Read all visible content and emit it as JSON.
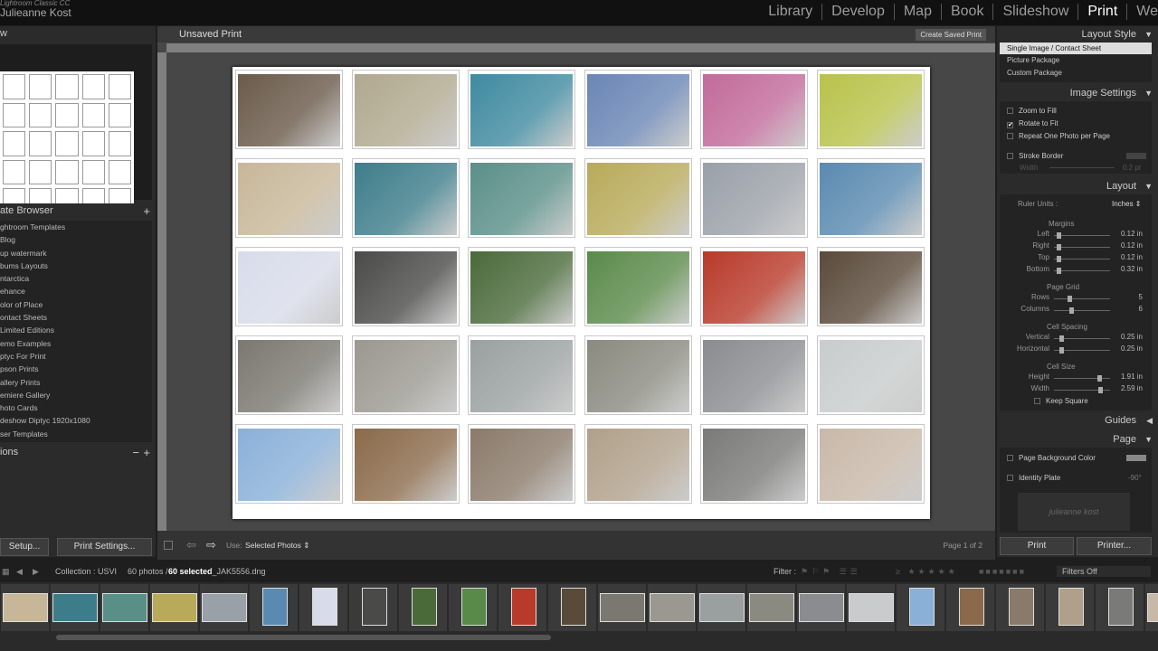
{
  "app": {
    "brand_line1": "Lightroom Classic CC",
    "brand_line2": "Julieanne Kost"
  },
  "modules": [
    {
      "label": "Library"
    },
    {
      "label": "Develop"
    },
    {
      "label": "Map"
    },
    {
      "label": "Book"
    },
    {
      "label": "Slideshow"
    },
    {
      "label": "Print",
      "active": true
    },
    {
      "label": "We"
    }
  ],
  "left": {
    "preview_label": "w",
    "template_browser": {
      "title": "ate Browser",
      "items": [
        "ghtroom Templates",
        "Blog",
        "up watermark",
        "bums Layouts",
        "ntarctica",
        "ehance",
        "olor of Place",
        "ontact Sheets",
        "Limited Editions",
        "emo Examples",
        "ptyc For Print",
        "pson Prints",
        "allery Prints",
        "emiere Gallery",
        "hoto Cards",
        "deshow Diptyc 1920x1080",
        "ser Templates"
      ]
    },
    "collections_label": "ions",
    "page_setup": "Setup...",
    "print_settings": "Print Settings..."
  },
  "center": {
    "title": "Unsaved Print",
    "create_saved": "Create Saved Print",
    "use_label": "Use:",
    "use_value": "Selected Photos",
    "page_indicator": "Page 1 of 2",
    "photo_colors": [
      [
        "#6a5a4a",
        "#b0a88e",
        "#3f8aa0",
        "#6a86b5",
        "#c26a9a",
        "#b8c24a"
      ],
      [
        "#c7b798",
        "#3d7d8a",
        "#5a8f88",
        "#b8aa5a",
        "#9aa0a8",
        "#5a8ab0"
      ],
      [
        "#d8dcea",
        "#4a4a48",
        "#4a6a3a",
        "#5a8a4a",
        "#b83a2a",
        "#5a4a3a"
      ],
      [
        "#7a7870",
        "#9a9890",
        "#9aa0a0",
        "#8a8a80",
        "#8a8c90",
        "#c8cccc"
      ],
      [
        "#8ab0d8",
        "#8a6a4a",
        "#8a7a6a",
        "#b0a08a",
        "#7a7a78",
        "#c8b8a8"
      ]
    ]
  },
  "right": {
    "layout_style": {
      "title": "Layout Style",
      "options": [
        "Single Image / Contact Sheet",
        "Picture Package",
        "Custom Package"
      ]
    },
    "image_settings": {
      "title": "Image Settings",
      "zoom": "Zoom to Fill",
      "rotate": "Rotate to Fit",
      "repeat": "Repeat One Photo per Page",
      "stroke": "Stroke Border",
      "width_label": "Width",
      "width_value": "0.2 pt"
    },
    "layout": {
      "title": "Layout",
      "ruler_units_label": "Ruler Units :",
      "ruler_units_value": "Inches",
      "margins_title": "Margins",
      "margins": [
        {
          "label": "Left",
          "value": "0.12",
          "unit": "in",
          "level": 0.05
        },
        {
          "label": "Right",
          "value": "0.12",
          "unit": "in",
          "level": 0.05
        },
        {
          "label": "Top",
          "value": "0.12",
          "unit": "in",
          "level": 0.05
        },
        {
          "label": "Bottom",
          "value": "0.32",
          "unit": "in",
          "level": 0.05
        }
      ],
      "grid_title": "Page Grid",
      "grid": [
        {
          "label": "Rows",
          "value": "5",
          "unit": "",
          "level": 0.25
        },
        {
          "label": "Columns",
          "value": "6",
          "unit": "",
          "level": 0.3
        }
      ],
      "spacing_title": "Cell Spacing",
      "spacing": [
        {
          "label": "Vertical",
          "value": "0.25",
          "unit": "in",
          "level": 0.1
        },
        {
          "label": "Horizontal",
          "value": "0.25",
          "unit": "in",
          "level": 0.1
        }
      ],
      "size_title": "Cell Size",
      "size": [
        {
          "label": "Height",
          "value": "1.91",
          "unit": "in",
          "level": 0.82
        },
        {
          "label": "Width",
          "value": "2.59",
          "unit": "in",
          "level": 0.85
        }
      ],
      "keep_square": "Keep Square"
    },
    "guides_title": "Guides",
    "page": {
      "title": "Page",
      "bg_color": "Page Background Color",
      "identity_plate": "Identity Plate",
      "identity_angle": "-90°",
      "identity_text": "julieanne kost"
    },
    "print_button": "Print",
    "printer_button": "Printer..."
  },
  "filmstrip": {
    "collection": "Collection : USVI",
    "count": "60 photos /",
    "selected": "60 selected",
    "file": "/_JAK5556.dng",
    "filter_label": "Filter :",
    "filters_off": "Filters Off",
    "thumbs": [
      "#c7b798",
      "#3d7d8a",
      "#5a8f88",
      "#b8aa5a",
      "#9aa0a8",
      "#5a8ab0",
      "#d8dcea",
      "#4a4a48",
      "#4a6a3a",
      "#5a8a4a",
      "#b83a2a",
      "#5a4a3a",
      "#7a7870",
      "#9a9890",
      "#9aa0a0",
      "#8a8a80",
      "#8a8c90",
      "#c8cccc",
      "#8ab0d8",
      "#8a6a4a",
      "#8a7a6a",
      "#b0a08a",
      "#7a7a78",
      "#c8b8a8"
    ]
  }
}
